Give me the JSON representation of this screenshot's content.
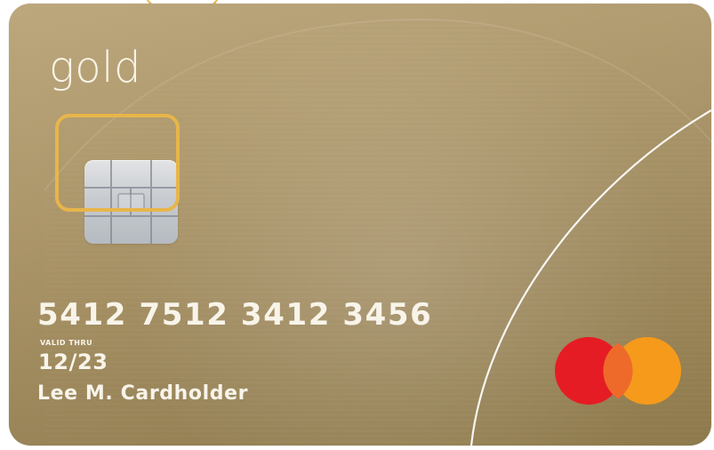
{
  "card": {
    "brand_text": "gold",
    "card_number": "5412 7512 3412 3456",
    "valid_label": "VALID THRU",
    "expiry": "12/23",
    "cardholder_name": "Lee M. Cardholder"
  },
  "style": {
    "card_color": "#ac9566",
    "text_color": "#f8f4ea",
    "highlight_color": "#e8b54a",
    "chip_color": "#c8ccd0",
    "logo_red": "#e61c24",
    "logo_orange": "#f59a1b",
    "logo_overlap": "#ee6a2a"
  },
  "icons": {
    "chip": "chip-icon",
    "payment_network": "mastercard-icon",
    "highlight": "chip-highlight-icon"
  }
}
